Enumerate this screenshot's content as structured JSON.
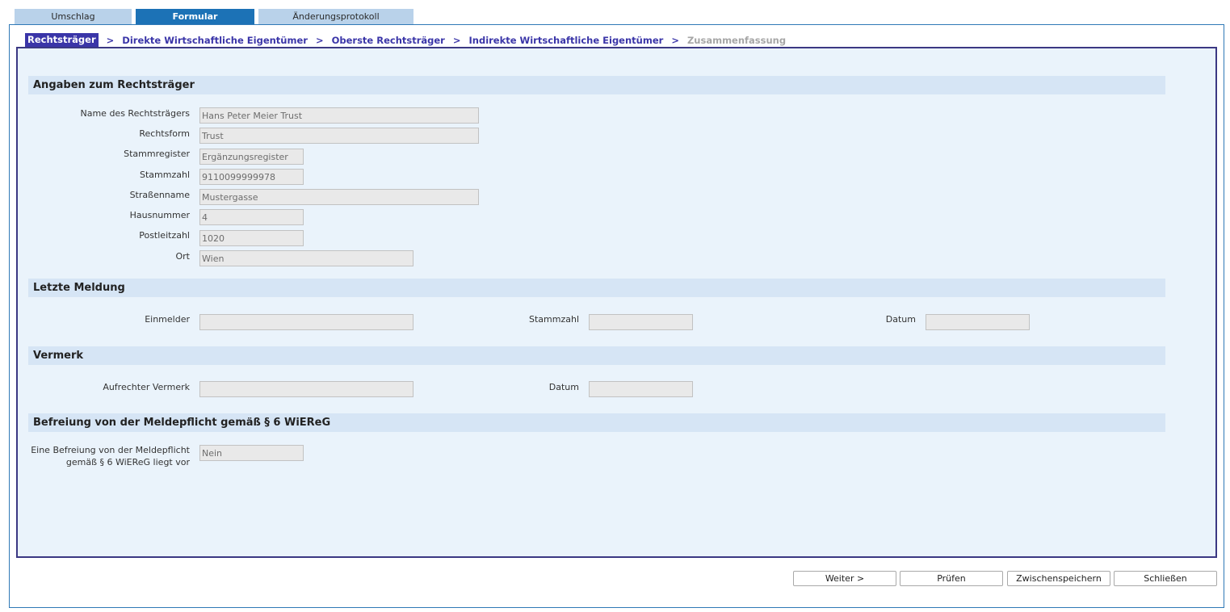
{
  "tabs": [
    {
      "label": "Umschlag"
    },
    {
      "label": "Formular"
    },
    {
      "label": "Änderungsprotokoll"
    }
  ],
  "steps": [
    {
      "label": "Rechtsträger"
    },
    {
      "label": "Direkte Wirtschaftliche Eigentümer"
    },
    {
      "label": "Oberste Rechtsträger"
    },
    {
      "label": "Indirekte Wirtschaftliche Eigentümer"
    },
    {
      "label": "Zusammenfassung"
    }
  ],
  "step_separator": ">",
  "sections": {
    "rechtstraeger": {
      "title": "Angaben zum Rechtsträger",
      "fields": [
        {
          "label": "Name des Rechtsträgers",
          "value": "Hans Peter Meier Trust"
        },
        {
          "label": "Rechtsform",
          "value": "Trust"
        },
        {
          "label": "Stammregister",
          "value": "Ergänzungsregister"
        },
        {
          "label": "Stammzahl",
          "value": "9110099999978"
        },
        {
          "label": "Straßenname",
          "value": "Mustergasse"
        },
        {
          "label": "Hausnummer",
          "value": "4"
        },
        {
          "label": "Postleitzahl",
          "value": "1020"
        },
        {
          "label": "Ort",
          "value": "Wien"
        }
      ]
    },
    "letzte_meldung": {
      "title": "Letzte Meldung",
      "einmelder_label": "Einmelder",
      "einmelder_value": "",
      "stammzahl_label": "Stammzahl",
      "stammzahl_value": "",
      "datum_label": "Datum",
      "datum_value": ""
    },
    "vermerk": {
      "title": "Vermerk",
      "aufrechter_label": "Aufrechter Vermerk",
      "aufrechter_value": "",
      "datum_label": "Datum",
      "datum_value": ""
    },
    "befreiung": {
      "title": "Befreiung von der Meldepflicht gemäß § 6 WiEReG",
      "label_line1": "Eine Befreiung von der Meldepflicht",
      "label_line2": "gemäß § 6 WiEReG liegt vor",
      "value": "Nein"
    }
  },
  "buttons": {
    "weiter": "Weiter >",
    "pruefen": "Prüfen",
    "zwischenspeichern": "Zwischenspeichern",
    "schliessen": "Schließen"
  }
}
